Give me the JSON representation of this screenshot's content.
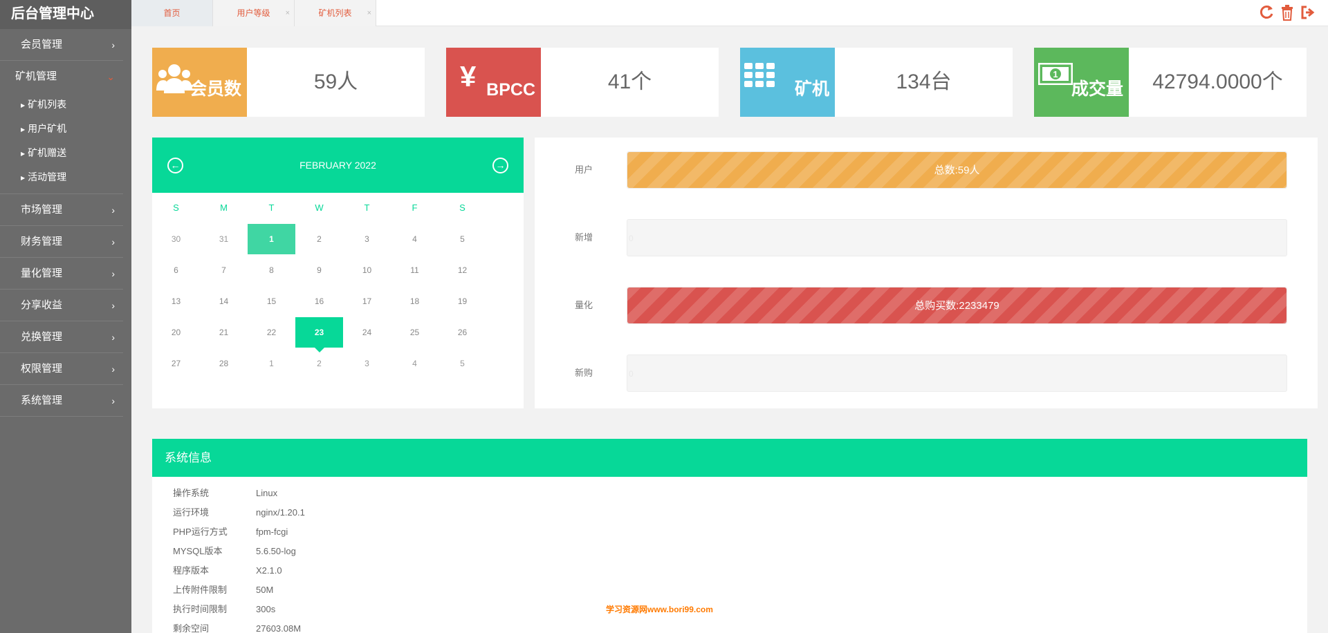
{
  "app": {
    "brand": "后台管理中心"
  },
  "sidebar": {
    "items": [
      {
        "label": "会员管理"
      },
      {
        "label": "矿机管理",
        "open": true,
        "children": [
          {
            "label": "矿机列表"
          },
          {
            "label": "用户矿机"
          },
          {
            "label": "矿机赠送"
          },
          {
            "label": "活动管理"
          }
        ]
      },
      {
        "label": "市场管理"
      },
      {
        "label": "财务管理"
      },
      {
        "label": "量化管理"
      },
      {
        "label": "分享收益"
      },
      {
        "label": "兑换管理"
      },
      {
        "label": "权限管理"
      },
      {
        "label": "系统管理"
      }
    ]
  },
  "tabs": [
    {
      "label": "首页",
      "active": true
    },
    {
      "label": "用户等级",
      "closable": true
    },
    {
      "label": "矿机列表",
      "closable": true
    }
  ],
  "top_icons": [
    "refresh-icon",
    "trash-icon",
    "logout-icon"
  ],
  "stats": [
    {
      "label": "会员数",
      "value": "59人",
      "color": "#f0ad4e",
      "icon": "users-icon"
    },
    {
      "label": "BPCC",
      "symbol": "¥",
      "value": "41个",
      "color": "#d9534f",
      "icon": "yen-icon"
    },
    {
      "label": "矿机",
      "value": "134台",
      "color": "#5bc0de",
      "icon": "grid-icon"
    },
    {
      "label": "成交量",
      "value": "42794.0000个",
      "color": "#5cb85c",
      "icon": "money-icon"
    }
  ],
  "calendar": {
    "title": "FEBRUARY 2022",
    "prev_icon": "arrow-left-icon",
    "next_icon": "arrow-right-icon",
    "weekdays": [
      "S",
      "M",
      "T",
      "W",
      "T",
      "F",
      "S"
    ],
    "weeks": [
      [
        "30",
        "31",
        "1",
        "2",
        "3",
        "4",
        "5"
      ],
      [
        "6",
        "7",
        "8",
        "9",
        "10",
        "11",
        "12"
      ],
      [
        "13",
        "14",
        "15",
        "16",
        "17",
        "18",
        "19"
      ],
      [
        "20",
        "21",
        "22",
        "23",
        "24",
        "25",
        "26"
      ],
      [
        "27",
        "28",
        "1",
        "2",
        "3",
        "4",
        "5"
      ]
    ],
    "selected": "1",
    "today": "23"
  },
  "progress": [
    {
      "label": "用户",
      "text": "总数:59人",
      "fill": 1.0,
      "color": "#f0ad4e"
    },
    {
      "label": "新增",
      "text": "0",
      "fill": 0,
      "color": "#5bc0de"
    },
    {
      "label": "量化",
      "text": "总购买数:2233479",
      "fill": 1.0,
      "color": "#d9534f"
    },
    {
      "label": "新购",
      "text": "0",
      "fill": 0,
      "color": "#5cb85c"
    }
  ],
  "system": {
    "title": "系统信息",
    "rows": [
      {
        "key": "操作系统",
        "value": "Linux"
      },
      {
        "key": "运行环境",
        "value": "nginx/1.20.1"
      },
      {
        "key": "PHP运行方式",
        "value": "fpm-fcgi"
      },
      {
        "key": "MYSQL版本",
        "value": "5.6.50-log"
      },
      {
        "key": "程序版本",
        "value": "X2.1.0"
      },
      {
        "key": "上传附件限制",
        "value": "50M"
      },
      {
        "key": "执行时间限制",
        "value": "300s"
      },
      {
        "key": "剩余空间",
        "value": "27603.08M"
      }
    ]
  },
  "watermark": "学习资源网www.bori99.com"
}
